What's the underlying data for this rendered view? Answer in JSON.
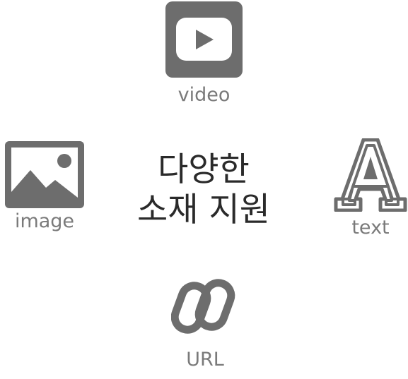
{
  "center": {
    "line1": "다양한",
    "line2": "소재 지원"
  },
  "nodes": {
    "video": {
      "label": "video",
      "icon": "video-play-icon"
    },
    "image": {
      "label": "image",
      "icon": "image-icon"
    },
    "text": {
      "label": "text",
      "icon": "text-letter-a-icon"
    },
    "url": {
      "label": "URL",
      "icon": "link-icon"
    }
  },
  "colors": {
    "icon": "#6d6d6d",
    "label": "#7a7a7a",
    "title": "#2a2a2a",
    "background": "#ffffff"
  }
}
